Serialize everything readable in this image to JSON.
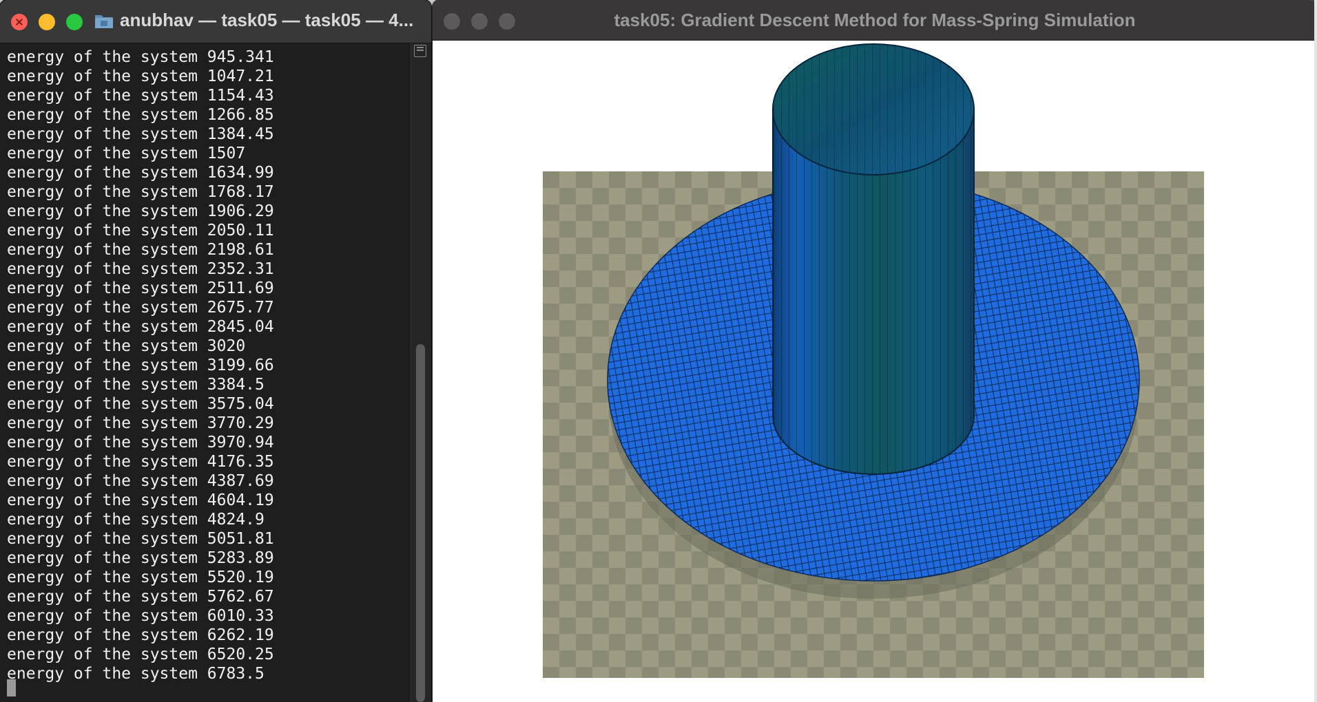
{
  "terminal": {
    "title": "anubhav — task05 — task05 — 4...",
    "lines": [
      "energy of the system 945.341",
      "energy of the system 1047.21",
      "energy of the system 1154.43",
      "energy of the system 1266.85",
      "energy of the system 1384.45",
      "energy of the system 1507",
      "energy of the system 1634.99",
      "energy of the system 1768.17",
      "energy of the system 1906.29",
      "energy of the system 2050.11",
      "energy of the system 2198.61",
      "energy of the system 2352.31",
      "energy of the system 2511.69",
      "energy of the system 2675.77",
      "energy of the system 2845.04",
      "energy of the system 3020",
      "energy of the system 3199.66",
      "energy of the system 3384.5",
      "energy of the system 3575.04",
      "energy of the system 3770.29",
      "energy of the system 3970.94",
      "energy of the system 4176.35",
      "energy of the system 4387.69",
      "energy of the system 4604.19",
      "energy of the system 4824.9",
      "energy of the system 5051.81",
      "energy of the system 5283.89",
      "energy of the system 5520.19",
      "energy of the system 5762.67",
      "energy of the system 6010.33",
      "energy of the system 6262.19",
      "energy of the system 6520.25",
      "energy of the system 6783.5"
    ],
    "icons": [
      "close-icon",
      "minimize-icon",
      "maximize-icon",
      "folder-icon",
      "scroll-split-icon"
    ]
  },
  "simulation": {
    "title": "task05: Gradient Descent Method for Mass-Spring Simulation",
    "colors": {
      "mesh": "#1f6ce0",
      "cylinder_dark": "#0f4f86",
      "cylinder_teal": "#0f5b62",
      "checker_light": "#9d9c83",
      "checker_dark": "#8a8a74",
      "shadow": "#6d6d5e"
    }
  }
}
